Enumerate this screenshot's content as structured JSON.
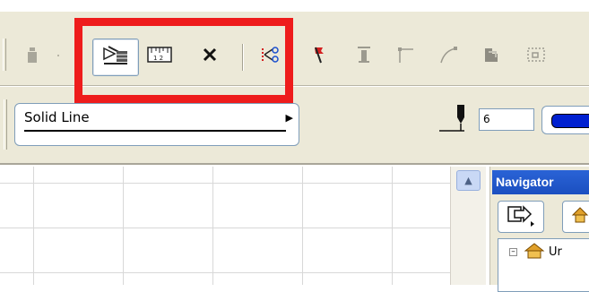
{
  "toolbar": {
    "tools": [
      {
        "icon": "figure-tool-icon"
      },
      {
        "icon": "hatch-arrow-icon"
      },
      {
        "icon": "dimension-ruler-icon"
      },
      {
        "icon": "cross-marker-icon"
      },
      {
        "icon": "split-scissors-icon"
      },
      {
        "icon": "flag-pen-icon"
      },
      {
        "icon": "elevation-marker-icon"
      },
      {
        "icon": "corner-line-icon"
      },
      {
        "icon": "arc-line-icon"
      },
      {
        "icon": "fill-object-icon"
      },
      {
        "icon": "marquee-select-icon"
      }
    ]
  },
  "line_type": {
    "selected": "Solid Line"
  },
  "pen": {
    "value": "6",
    "color": "#0020d0"
  },
  "navigator": {
    "title": "Navigator",
    "tree_item": "Ur"
  },
  "colors": {
    "highlight": "#ee1c1c",
    "title_bar": "#2a63d6",
    "toolbar_bg": "#ece9d8"
  }
}
